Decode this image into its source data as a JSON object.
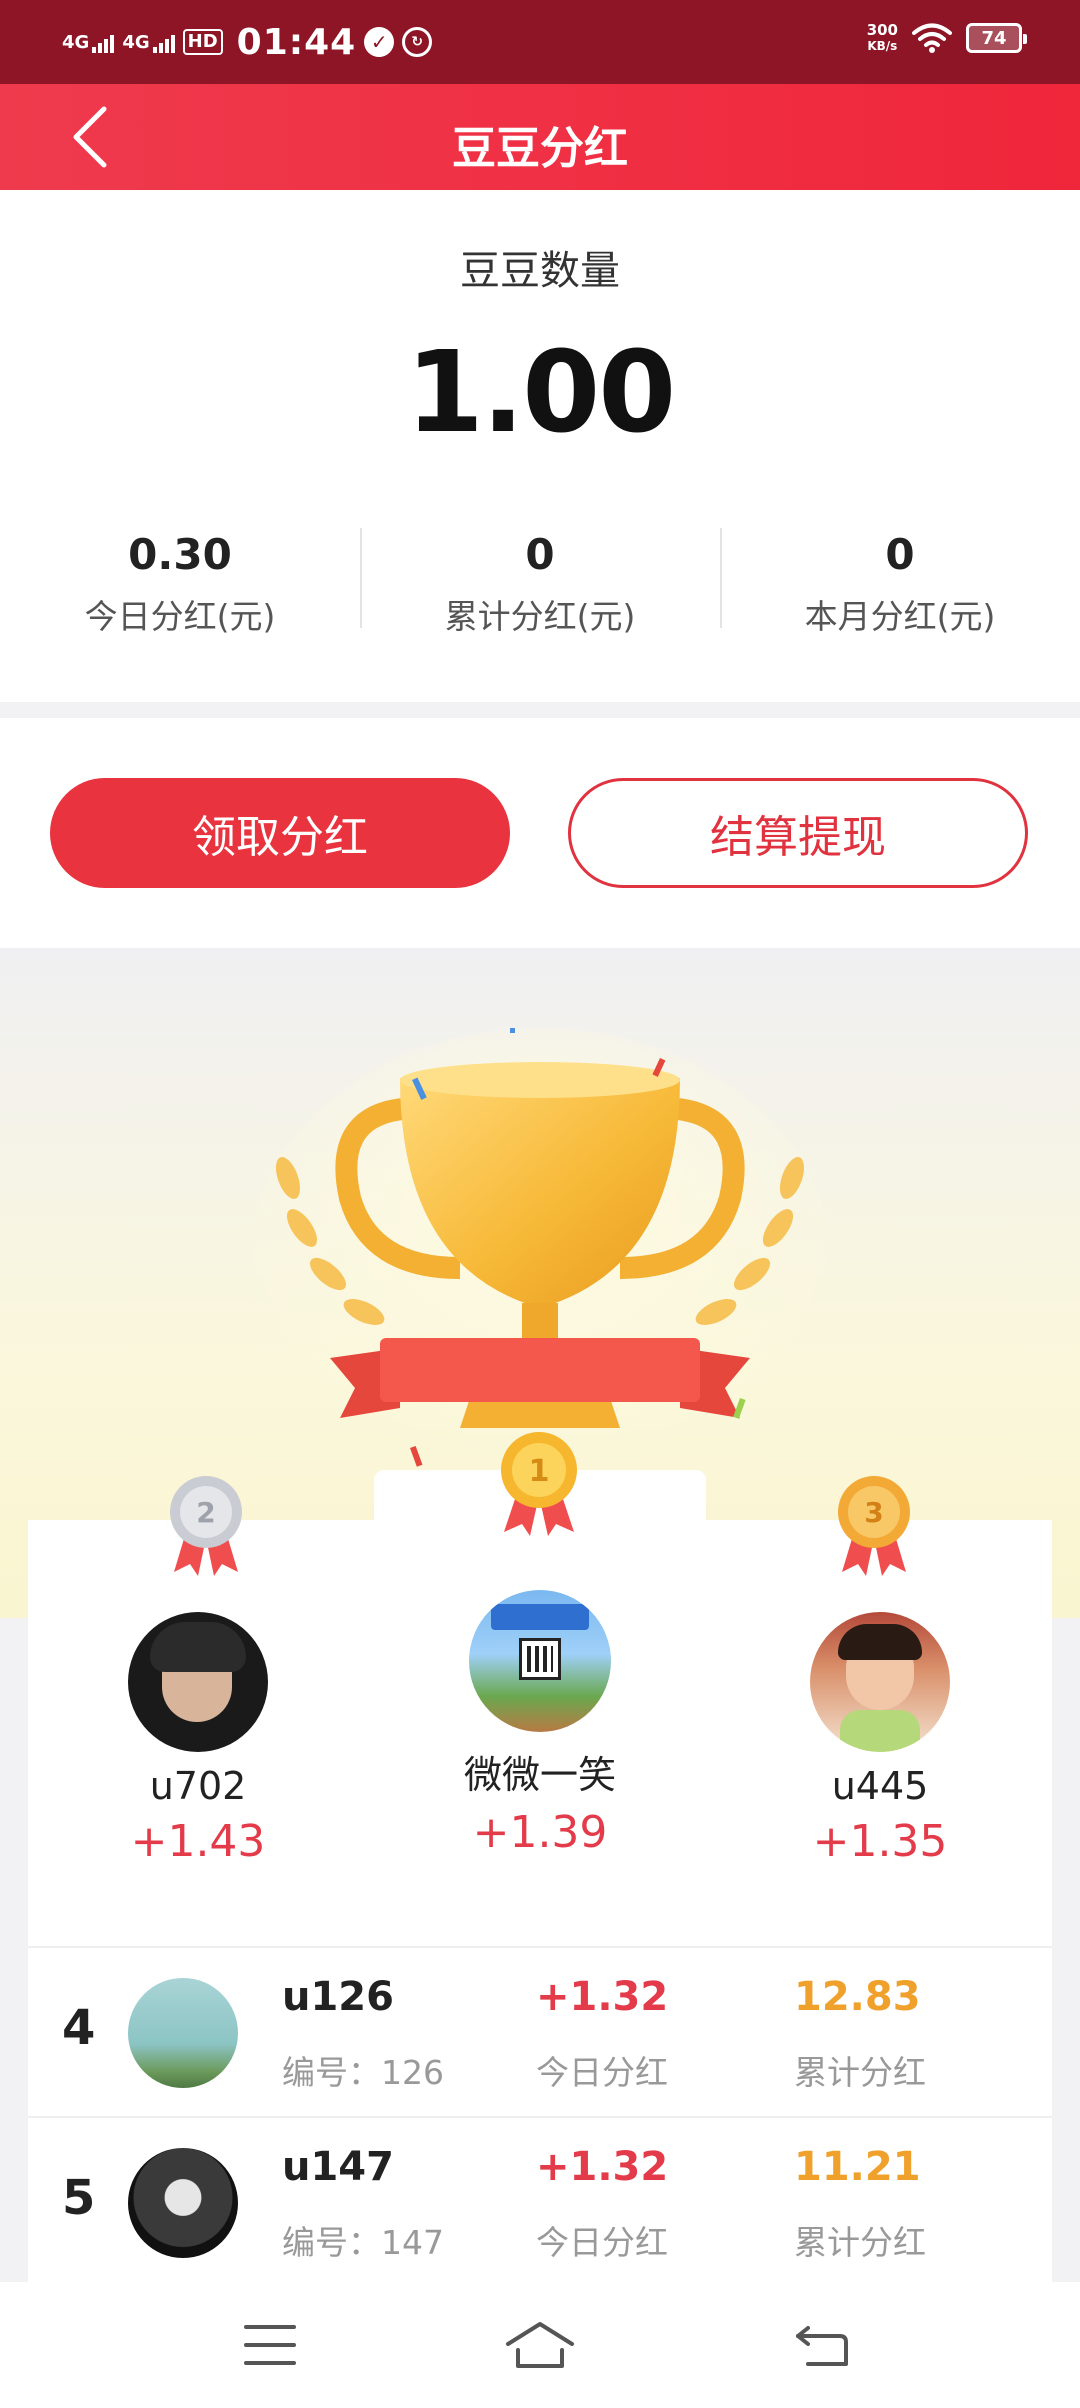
{
  "status_bar": {
    "network1": "4G",
    "network2": "4G",
    "hd": "HD",
    "time": "01:44",
    "speed_value": "300",
    "speed_unit": "KB/s",
    "battery": "74"
  },
  "header": {
    "title": "豆豆分红"
  },
  "summary": {
    "bean_label": "豆豆数量",
    "bean_value": "1.00",
    "stats": [
      {
        "value": "0.30",
        "label": "今日分红(元)"
      },
      {
        "value": "0",
        "label": "累计分红(元)"
      },
      {
        "value": "0",
        "label": "本月分红(元)"
      }
    ]
  },
  "actions": {
    "claim_label": "领取分红",
    "withdraw_label": "结算提现"
  },
  "podium": {
    "first": {
      "rank": "1",
      "name": "微微一笑",
      "gain": "+1.39"
    },
    "second": {
      "rank": "2",
      "name": "u702",
      "gain": "+1.43"
    },
    "third": {
      "rank": "3",
      "name": "u445",
      "gain": "+1.35"
    }
  },
  "ranking": [
    {
      "rank": "4",
      "name": "u126",
      "id": "编号：126",
      "today": "+1.32",
      "today_label": "今日分红",
      "total": "12.83",
      "total_label": "累计分红"
    },
    {
      "rank": "5",
      "name": "u147",
      "id": "编号：147",
      "today": "+1.32",
      "today_label": "今日分红",
      "total": "11.21",
      "total_label": "累计分红"
    }
  ],
  "colors": {
    "brand_red": "#ef3a4d",
    "status_bar": "#8e1526",
    "gain_red": "#e33b4a",
    "total_orange": "#f0a12b"
  },
  "icons": {
    "back": "chevron-left-icon",
    "menu": "menu-icon",
    "home": "home-icon",
    "return": "return-icon"
  }
}
